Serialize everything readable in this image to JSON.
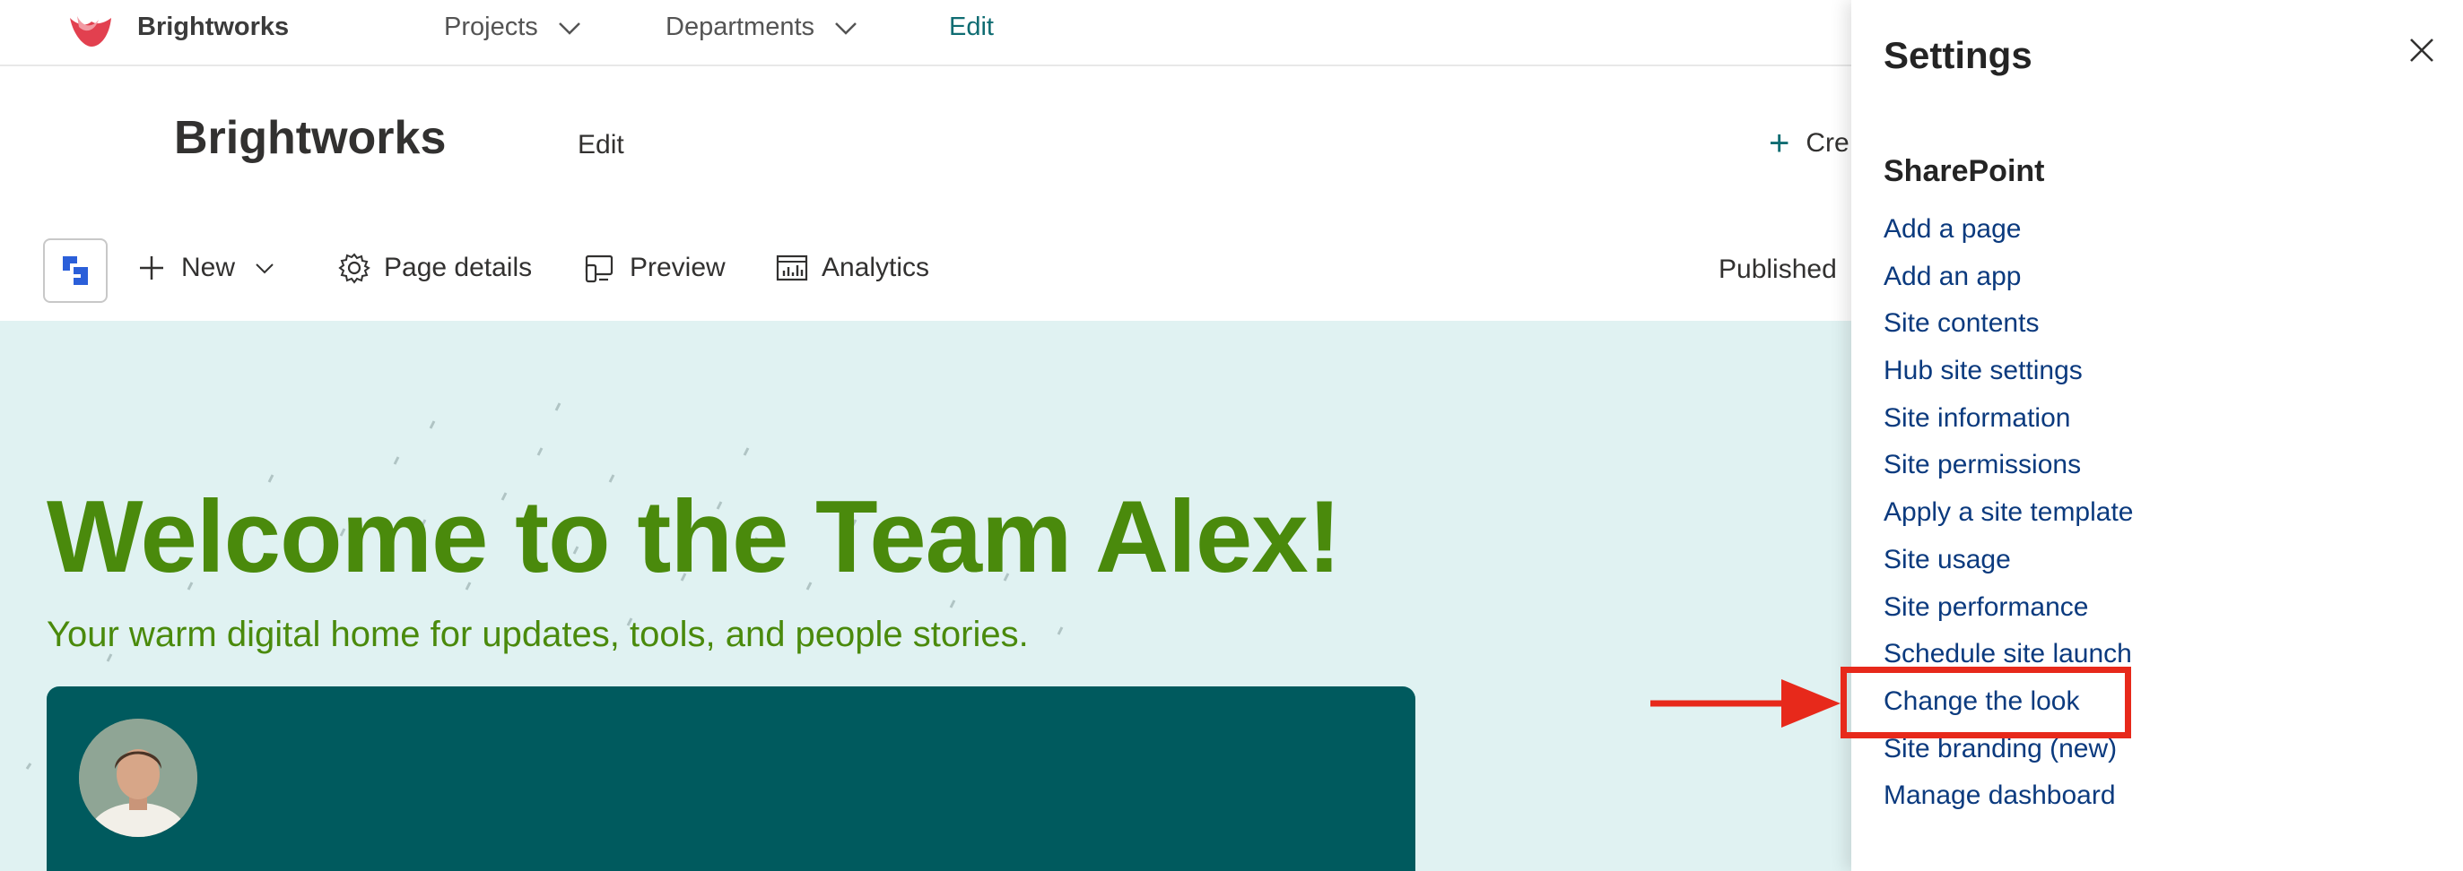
{
  "topnav": {
    "brand": "Brightworks",
    "items": [
      {
        "label": "Projects"
      },
      {
        "label": "Departments"
      },
      {
        "label": "Edit"
      }
    ]
  },
  "site_header": {
    "title": "Brightworks",
    "edit_label": "Edit",
    "create_label": "Cre"
  },
  "command_bar": {
    "new_label": "New",
    "page_details_label": "Page details",
    "preview_label": "Preview",
    "analytics_label": "Analytics",
    "published_label": "Published"
  },
  "hero": {
    "title": "Welcome to the Team Alex!",
    "subtitle": "Your warm digital home for updates, tools, and people stories.",
    "card_text": ""
  },
  "settings_panel": {
    "title": "Settings",
    "section": "SharePoint",
    "links": [
      "Add a page",
      "Add an app",
      "Site contents",
      "Hub site settings",
      "Site information",
      "Site permissions",
      "Apply a site template",
      "Site usage",
      "Site performance",
      "Schedule site launch",
      "Change the look",
      "Site branding (new)",
      "Manage dashboard"
    ]
  },
  "colors": {
    "hero_green": "#4a8a0c",
    "hero_bg": "#e0f2f2",
    "card_teal": "#005a5e",
    "link_blue": "#0b3a7e",
    "annotation_red": "#e7291b",
    "nav_accent": "#0f6c72"
  }
}
